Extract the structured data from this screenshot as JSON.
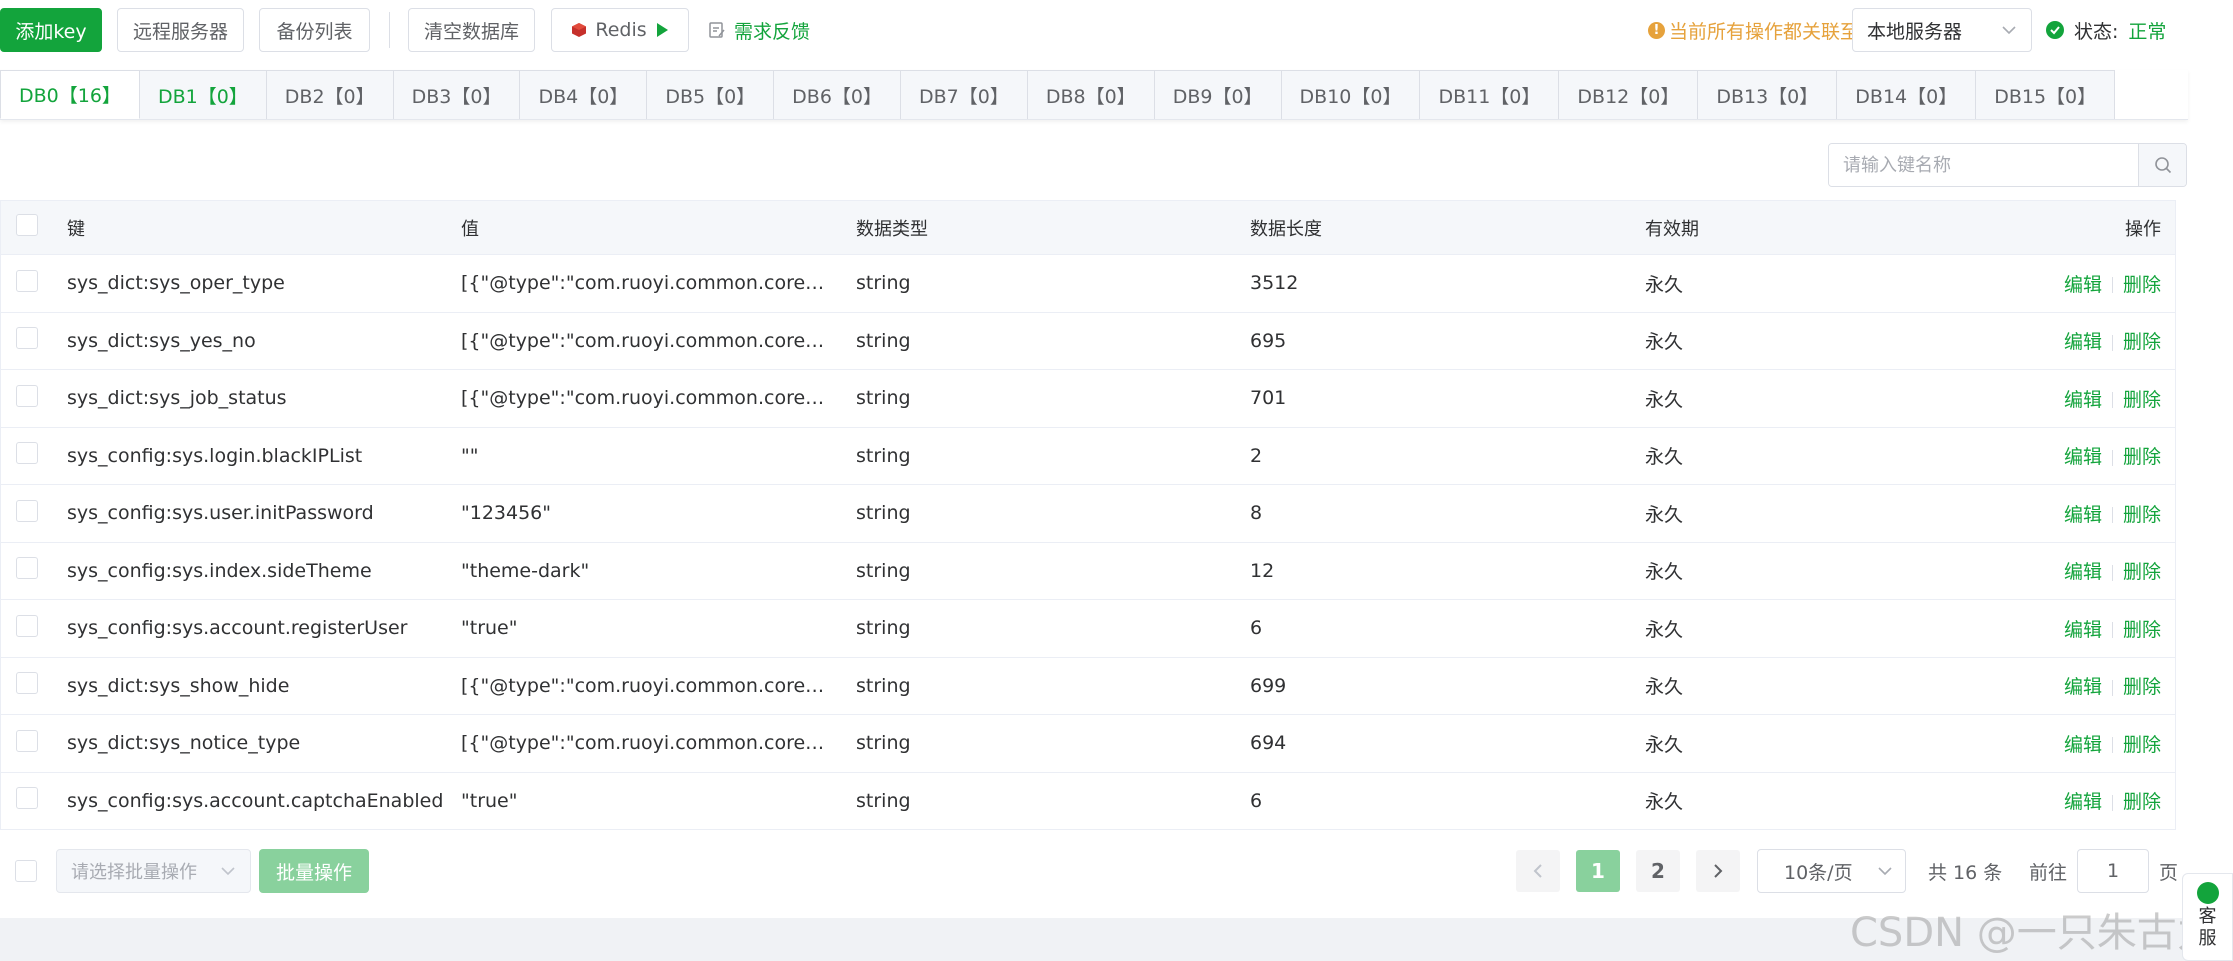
{
  "toolbar": {
    "add_key": "添加key",
    "remote_server": "远程服务器",
    "backup_list": "备份列表",
    "clear_db": "清空数据库",
    "redis": "Redis",
    "feedback": "需求反馈",
    "notice": "当前所有操作都关联至",
    "server": "本地服务器",
    "status_label": "状态:",
    "status_value": "正常"
  },
  "tabs": [
    {
      "label": "DB0【16】"
    },
    {
      "label": "DB1【0】"
    },
    {
      "label": "DB2【0】"
    },
    {
      "label": "DB3【0】"
    },
    {
      "label": "DB4【0】"
    },
    {
      "label": "DB5【0】"
    },
    {
      "label": "DB6【0】"
    },
    {
      "label": "DB7【0】"
    },
    {
      "label": "DB8【0】"
    },
    {
      "label": "DB9【0】"
    },
    {
      "label": "DB10【0】"
    },
    {
      "label": "DB11【0】"
    },
    {
      "label": "DB12【0】"
    },
    {
      "label": "DB13【0】"
    },
    {
      "label": "DB14【0】"
    },
    {
      "label": "DB15【0】"
    }
  ],
  "search": {
    "placeholder": "请输入键名称"
  },
  "table": {
    "headers": {
      "key": "键",
      "value": "值",
      "type": "数据类型",
      "length": "数据长度",
      "ttl": "有效期",
      "ops": "操作"
    },
    "edit": "编辑",
    "delete": "删除",
    "rows": [
      {
        "key": "sys_dict:sys_oper_type",
        "value": "[{\"@type\":\"com.ruoyi.common.core.dom...",
        "type": "string",
        "length": "3512",
        "ttl": "永久"
      },
      {
        "key": "sys_dict:sys_yes_no",
        "value": "[{\"@type\":\"com.ruoyi.common.core.dom...",
        "type": "string",
        "length": "695",
        "ttl": "永久"
      },
      {
        "key": "sys_dict:sys_job_status",
        "value": "[{\"@type\":\"com.ruoyi.common.core.dom...",
        "type": "string",
        "length": "701",
        "ttl": "永久"
      },
      {
        "key": "sys_config:sys.login.blackIPList",
        "value": "\"\"",
        "type": "string",
        "length": "2",
        "ttl": "永久"
      },
      {
        "key": "sys_config:sys.user.initPassword",
        "value": "\"123456\"",
        "type": "string",
        "length": "8",
        "ttl": "永久"
      },
      {
        "key": "sys_config:sys.index.sideTheme",
        "value": "\"theme-dark\"",
        "type": "string",
        "length": "12",
        "ttl": "永久"
      },
      {
        "key": "sys_config:sys.account.registerUser",
        "value": "\"true\"",
        "type": "string",
        "length": "6",
        "ttl": "永久"
      },
      {
        "key": "sys_dict:sys_show_hide",
        "value": "[{\"@type\":\"com.ruoyi.common.core.dom...",
        "type": "string",
        "length": "699",
        "ttl": "永久"
      },
      {
        "key": "sys_dict:sys_notice_type",
        "value": "[{\"@type\":\"com.ruoyi.common.core.dom...",
        "type": "string",
        "length": "694",
        "ttl": "永久"
      },
      {
        "key": "sys_config:sys.account.captchaEnabled",
        "value": "\"true\"",
        "type": "string",
        "length": "6",
        "ttl": "永久"
      }
    ]
  },
  "footer": {
    "batch_placeholder": "请选择批量操作",
    "batch_button": "批量操作",
    "pages": [
      "1",
      "2"
    ],
    "page_size": "10条/页",
    "total": "共 16 条",
    "goto_label": "前往",
    "goto_value": "1",
    "goto_suffix": "页"
  },
  "watermark": "CSDN @一只朱古力",
  "service": "客服",
  "colors": {
    "accent": "#13a43c",
    "accent_light": "#89d19d",
    "warning": "#e6a23c"
  }
}
